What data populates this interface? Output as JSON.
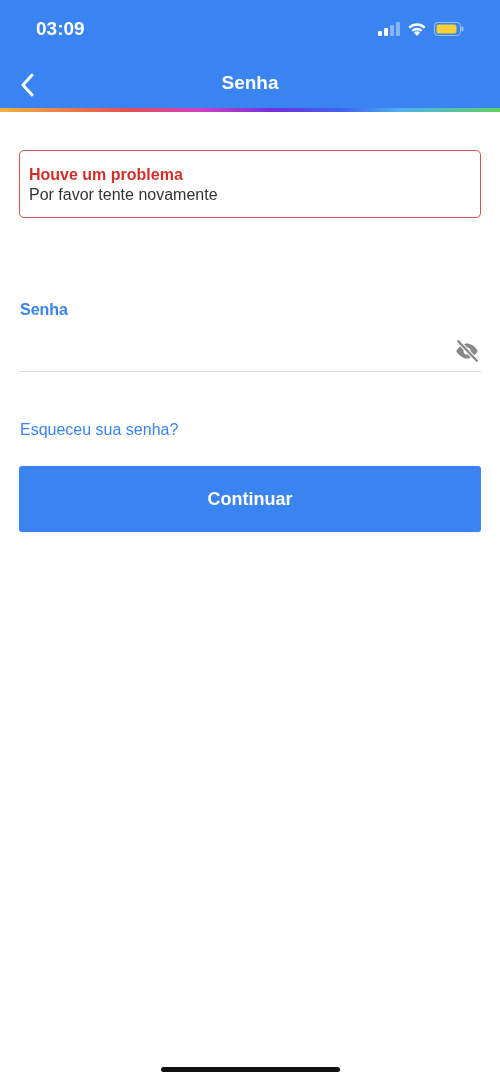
{
  "status_bar": {
    "time": "03:09"
  },
  "nav": {
    "title": "Senha"
  },
  "alert": {
    "title": "Houve um problema",
    "message": "Por favor tente novamente"
  },
  "password_field": {
    "label": "Senha",
    "password_visible": false
  },
  "forgot_link": "Esqueceu sua senha?",
  "continue_button": "Continuar"
}
